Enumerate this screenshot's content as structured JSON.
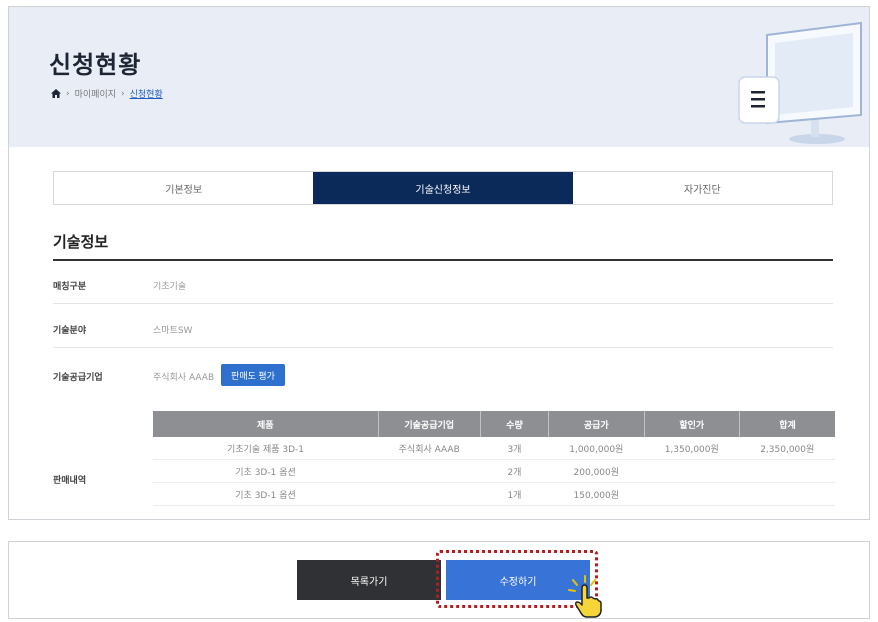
{
  "header": {
    "title": "신청현황",
    "breadcrumb": [
      "마이페이지",
      "신청현황"
    ]
  },
  "tabs": [
    {
      "label": "기본정보",
      "active": false
    },
    {
      "label": "기술신청정보",
      "active": true
    },
    {
      "label": "자가진단",
      "active": false
    }
  ],
  "section": {
    "title": "기술정보",
    "fields": [
      {
        "label": "매칭구분",
        "value": "기초기술"
      },
      {
        "label": "기술분야",
        "value": "스마트SW"
      },
      {
        "label": "기술공급기업",
        "value": "주식회사 AAAB"
      }
    ],
    "lookup_button": "판매도 평가",
    "detail_label": "판매내역"
  },
  "table": {
    "headers": [
      "제품",
      "기술공급기업",
      "수량",
      "공급가",
      "할인가",
      "합계"
    ],
    "rows": [
      [
        "기초기술 제품 3D-1",
        "주식회사 AAAB",
        "3개",
        "1,000,000원",
        "1,350,000원",
        "2,350,000원"
      ],
      [
        "기초 3D-1 옵션",
        "",
        "2개",
        "200,000원",
        "",
        ""
      ],
      [
        "기초 3D-1 옵션",
        "",
        "1개",
        "150,000원",
        "",
        ""
      ]
    ]
  },
  "actions": {
    "list_label": "목록가기",
    "edit_label": "수정하기"
  },
  "colors": {
    "active_tab": "#0b2a5a",
    "primary": "#2f70cf",
    "highlight": "#b41e1e"
  }
}
